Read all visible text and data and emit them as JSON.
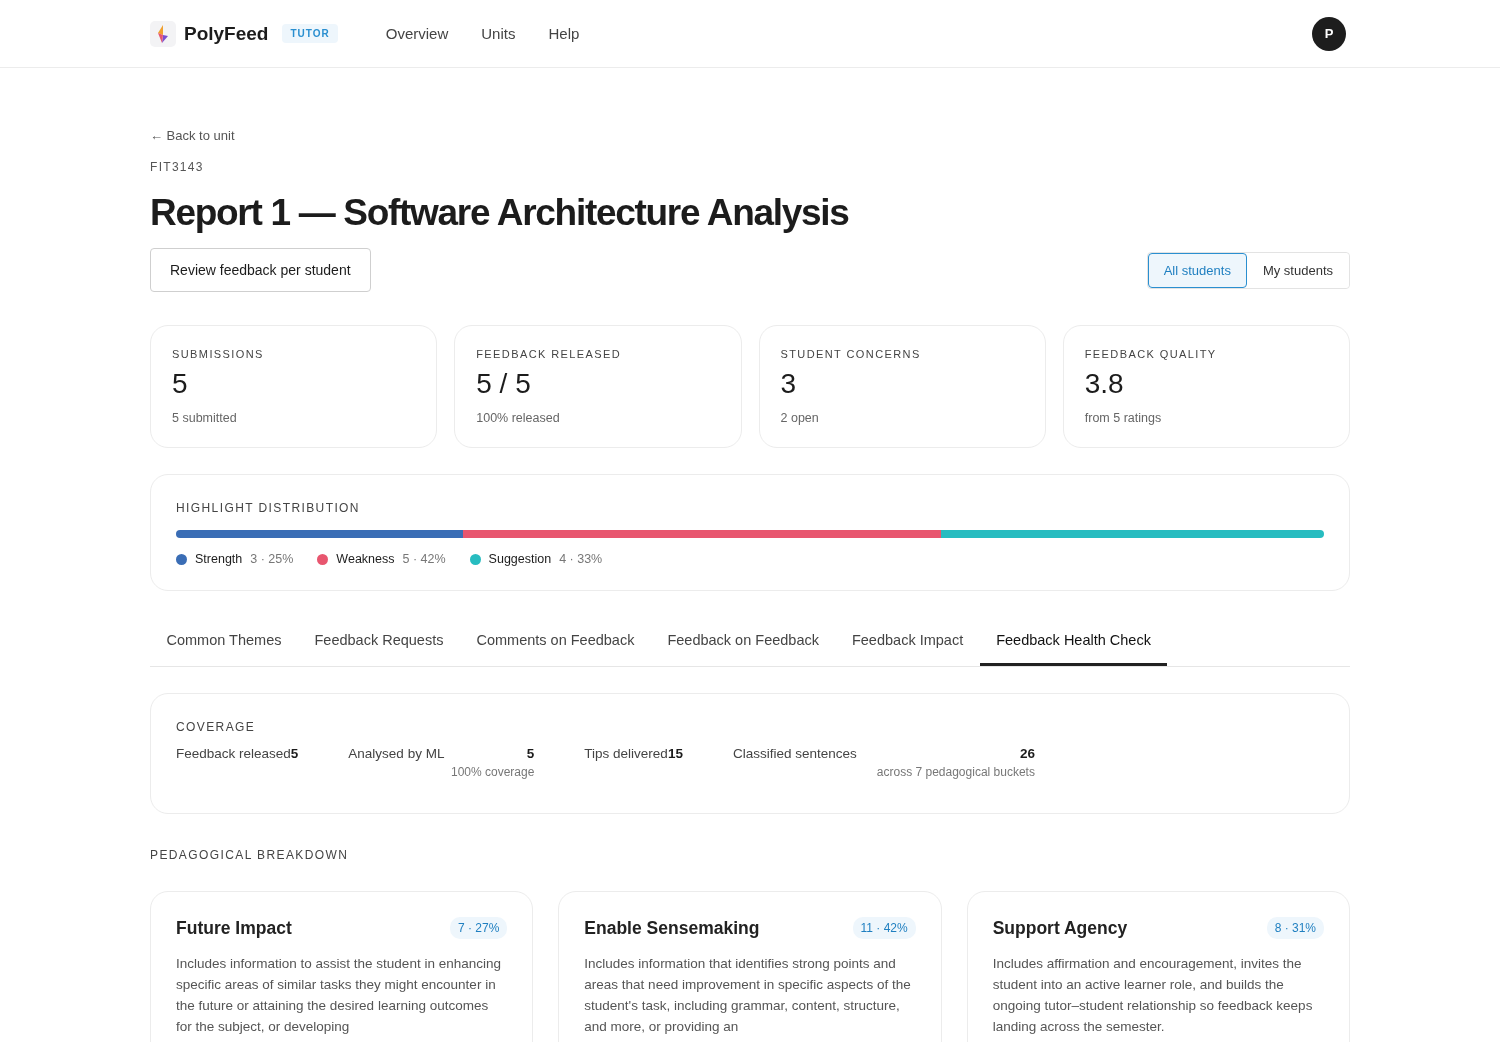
{
  "header": {
    "brand": "PolyFeed",
    "role_badge": "TUTOR",
    "nav": [
      {
        "label": "Overview"
      },
      {
        "label": "Units"
      },
      {
        "label": "Help"
      }
    ],
    "avatar": "P"
  },
  "back_link": "← Back to unit",
  "unit_code": "FIT3143",
  "title": "Report 1 — Software Architecture Analysis",
  "review_button": "Review feedback per student",
  "scope_toggle": [
    {
      "label": "All students",
      "selected": true
    },
    {
      "label": "My students",
      "selected": false
    }
  ],
  "stats": [
    {
      "label": "SUBMISSIONS",
      "value": "5",
      "sub": "5 submitted"
    },
    {
      "label": "FEEDBACK RELEASED",
      "value": "5 / 5",
      "sub": "100% released"
    },
    {
      "label": "STUDENT CONCERNS",
      "value": "3",
      "sub": "2 open"
    },
    {
      "label": "FEEDBACK QUALITY",
      "value": "3.8",
      "sub": "from 5 ratings"
    }
  ],
  "highlight_distribution": {
    "title": "HIGHLIGHT DISTRIBUTION",
    "segments": [
      {
        "name": "Strength",
        "count": "3 · 25%",
        "color": "#3a6db5"
      },
      {
        "name": "Weakness",
        "count": "5 · 42%",
        "color": "#e8566f"
      },
      {
        "name": "Suggestion",
        "count": "4 · 33%",
        "color": "#27bcc0"
      }
    ]
  },
  "tabs": [
    {
      "label": "Common Themes",
      "selected": false
    },
    {
      "label": "Feedback Requests",
      "selected": false
    },
    {
      "label": "Comments on Feedback",
      "selected": false
    },
    {
      "label": "Feedback on Feedback",
      "selected": false
    },
    {
      "label": "Feedback Impact",
      "selected": false
    },
    {
      "label": "Feedback Health Check",
      "selected": true
    }
  ],
  "coverage": {
    "title": "COVERAGE",
    "items": [
      {
        "label": "Feedback released",
        "value": "5"
      },
      {
        "label": "Analysed by ML",
        "value": "5",
        "sub": "100% coverage"
      },
      {
        "label": "Tips delivered",
        "value": "15"
      },
      {
        "label": "Classified sentences",
        "value": "26",
        "sub": "across 7 pedagogical buckets"
      }
    ]
  },
  "breakdown": {
    "title": "PEDAGOGICAL BREAKDOWN",
    "cards": [
      {
        "title": "Future Impact",
        "badge": "7 · 27%",
        "description": "Includes information to assist the student in enhancing specific areas of similar tasks they might encounter in the future or attaining the desired learning outcomes for the subject, or developing"
      },
      {
        "title": "Enable Sensemaking",
        "badge": "11 · 42%",
        "description": "Includes information that identifies strong points and areas that need improvement in specific aspects of the student's task, including grammar, content, structure, and more, or providing an"
      },
      {
        "title": "Support Agency",
        "badge": "8 · 31%",
        "description": "Includes affirmation and encouragement, invites the student into an active learner role, and builds the ongoing tutor–student relationship so feedback keeps landing across the semester."
      }
    ]
  }
}
